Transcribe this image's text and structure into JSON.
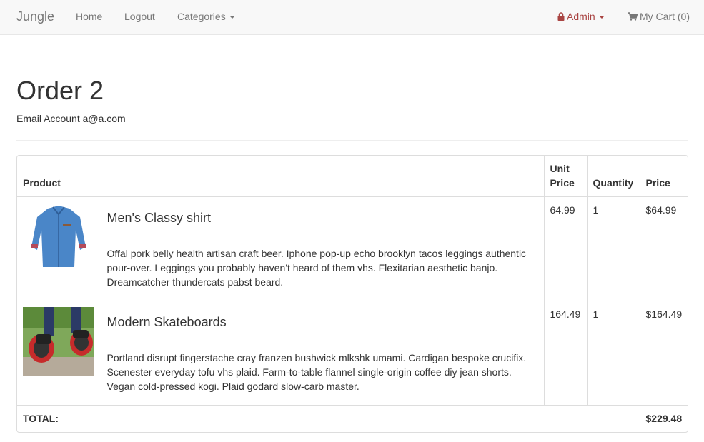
{
  "nav": {
    "brand": "Jungle",
    "home": "Home",
    "logout": "Logout",
    "categories": "Categories",
    "admin": "Admin",
    "cart": "My Cart (0)"
  },
  "order": {
    "title": "Order 2",
    "email": "Email Account a@a.com"
  },
  "table": {
    "headers": {
      "product": "Product",
      "unit_price": "Unit Price",
      "quantity": "Quantity",
      "price": "Price"
    },
    "rows": [
      {
        "name": "Men's Classy shirt",
        "description": "Offal pork belly health artisan craft beer. Iphone pop-up echo brooklyn tacos leggings authentic pour-over. Leggings you probably haven't heard of them vhs. Flexitarian aesthetic banjo. Dreamcatcher thundercats pabst beard.",
        "unit_price": "64.99",
        "quantity": "1",
        "price": "$64.99"
      },
      {
        "name": "Modern Skateboards",
        "description": "Portland disrupt fingerstache cray franzen bushwick mlkshk umami. Cardigan bespoke crucifix. Scenester everyday tofu vhs plaid. Farm-to-table flannel single-origin coffee diy jean shorts. Vegan cold-pressed kogi. Plaid godard slow-carb master.",
        "unit_price": "164.49",
        "quantity": "1",
        "price": "$164.49"
      }
    ],
    "total_label": "TOTAL:",
    "total_value": "$229.48"
  },
  "colors": {
    "navbar_bg": "#f8f8f8",
    "admin": "#a94442",
    "border": "#dddddd"
  }
}
